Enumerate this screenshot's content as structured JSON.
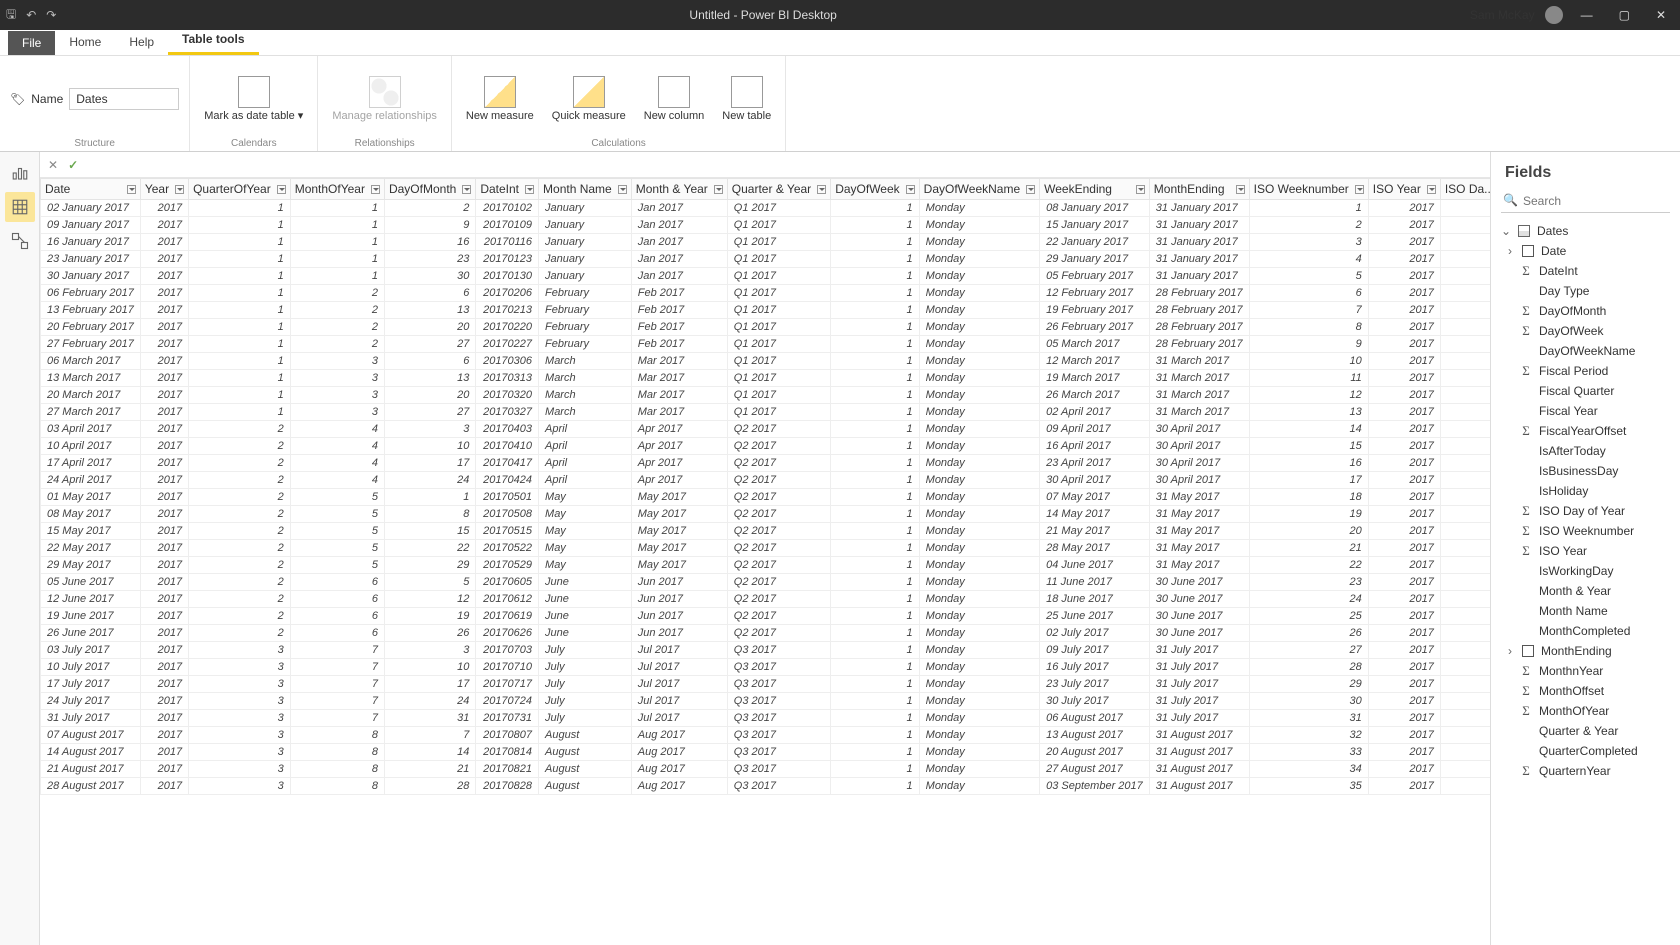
{
  "titlebar": {
    "title": "Untitled - Power BI Desktop",
    "user": "Sam McKay"
  },
  "menu": {
    "file": "File",
    "tabs": [
      "Home",
      "Help",
      "Table tools"
    ],
    "active": "Table tools"
  },
  "ribbon": {
    "name_label": "Name",
    "name_value": "Dates",
    "mark": "Mark as date\ntable ▾",
    "manage": "Manage\nrelationships",
    "new_measure": "New\nmeasure",
    "quick_measure": "Quick\nmeasure",
    "new_column": "New\ncolumn",
    "new_table": "New\ntable",
    "g1": "Structure",
    "g2": "Calendars",
    "g3": "Relationships",
    "g4": "Calculations"
  },
  "fields_panel": {
    "title": "Fields",
    "search_placeholder": "Search",
    "table": "Dates",
    "items": [
      {
        "t": "date",
        "n": "Date",
        "exp": true
      },
      {
        "t": "sigma",
        "n": "DateInt"
      },
      {
        "t": "none",
        "n": "Day Type"
      },
      {
        "t": "sigma",
        "n": "DayOfMonth"
      },
      {
        "t": "sigma",
        "n": "DayOfWeek"
      },
      {
        "t": "none",
        "n": "DayOfWeekName"
      },
      {
        "t": "sigma",
        "n": "Fiscal Period"
      },
      {
        "t": "none",
        "n": "Fiscal Quarter"
      },
      {
        "t": "none",
        "n": "Fiscal Year"
      },
      {
        "t": "sigma",
        "n": "FiscalYearOffset"
      },
      {
        "t": "none",
        "n": "IsAfterToday"
      },
      {
        "t": "none",
        "n": "IsBusinessDay"
      },
      {
        "t": "none",
        "n": "IsHoliday"
      },
      {
        "t": "sigma",
        "n": "ISO Day of Year"
      },
      {
        "t": "sigma",
        "n": "ISO Weeknumber"
      },
      {
        "t": "sigma",
        "n": "ISO Year"
      },
      {
        "t": "none",
        "n": "IsWorkingDay"
      },
      {
        "t": "none",
        "n": "Month & Year"
      },
      {
        "t": "none",
        "n": "Month Name"
      },
      {
        "t": "none",
        "n": "MonthCompleted"
      },
      {
        "t": "date",
        "n": "MonthEnding",
        "exp": true
      },
      {
        "t": "sigma",
        "n": "MonthnYear"
      },
      {
        "t": "sigma",
        "n": "MonthOffset"
      },
      {
        "t": "sigma",
        "n": "MonthOfYear"
      },
      {
        "t": "none",
        "n": "Quarter & Year"
      },
      {
        "t": "none",
        "n": "QuarterCompleted"
      },
      {
        "t": "sigma",
        "n": "QuarternYear"
      }
    ]
  },
  "columns": [
    "Date",
    "Year",
    "QuarterOfYear",
    "MonthOfYear",
    "DayOfMonth",
    "DateInt",
    "Month Name",
    "Month & Year",
    "Quarter & Year",
    "DayOfWeek",
    "DayOfWeekName",
    "WeekEnding",
    "MonthEnding",
    "ISO Weeknumber",
    "ISO Year",
    "ISO Da..."
  ],
  "rows": [
    [
      "02 January 2017",
      "2017",
      "1",
      "1",
      "2",
      "20170102",
      "January",
      "Jan 2017",
      "Q1 2017",
      "1",
      "Monday",
      "08 January 2017",
      "31 January 2017",
      "1",
      "2017",
      ""
    ],
    [
      "09 January 2017",
      "2017",
      "1",
      "1",
      "9",
      "20170109",
      "January",
      "Jan 2017",
      "Q1 2017",
      "1",
      "Monday",
      "15 January 2017",
      "31 January 2017",
      "2",
      "2017",
      ""
    ],
    [
      "16 January 2017",
      "2017",
      "1",
      "1",
      "16",
      "20170116",
      "January",
      "Jan 2017",
      "Q1 2017",
      "1",
      "Monday",
      "22 January 2017",
      "31 January 2017",
      "3",
      "2017",
      ""
    ],
    [
      "23 January 2017",
      "2017",
      "1",
      "1",
      "23",
      "20170123",
      "January",
      "Jan 2017",
      "Q1 2017",
      "1",
      "Monday",
      "29 January 2017",
      "31 January 2017",
      "4",
      "2017",
      ""
    ],
    [
      "30 January 2017",
      "2017",
      "1",
      "1",
      "30",
      "20170130",
      "January",
      "Jan 2017",
      "Q1 2017",
      "1",
      "Monday",
      "05 February 2017",
      "31 January 2017",
      "5",
      "2017",
      ""
    ],
    [
      "06 February 2017",
      "2017",
      "1",
      "2",
      "6",
      "20170206",
      "February",
      "Feb 2017",
      "Q1 2017",
      "1",
      "Monday",
      "12 February 2017",
      "28 February 2017",
      "6",
      "2017",
      ""
    ],
    [
      "13 February 2017",
      "2017",
      "1",
      "2",
      "13",
      "20170213",
      "February",
      "Feb 2017",
      "Q1 2017",
      "1",
      "Monday",
      "19 February 2017",
      "28 February 2017",
      "7",
      "2017",
      ""
    ],
    [
      "20 February 2017",
      "2017",
      "1",
      "2",
      "20",
      "20170220",
      "February",
      "Feb 2017",
      "Q1 2017",
      "1",
      "Monday",
      "26 February 2017",
      "28 February 2017",
      "8",
      "2017",
      ""
    ],
    [
      "27 February 2017",
      "2017",
      "1",
      "2",
      "27",
      "20170227",
      "February",
      "Feb 2017",
      "Q1 2017",
      "1",
      "Monday",
      "05 March 2017",
      "28 February 2017",
      "9",
      "2017",
      ""
    ],
    [
      "06 March 2017",
      "2017",
      "1",
      "3",
      "6",
      "20170306",
      "March",
      "Mar 2017",
      "Q1 2017",
      "1",
      "Monday",
      "12 March 2017",
      "31 March 2017",
      "10",
      "2017",
      ""
    ],
    [
      "13 March 2017",
      "2017",
      "1",
      "3",
      "13",
      "20170313",
      "March",
      "Mar 2017",
      "Q1 2017",
      "1",
      "Monday",
      "19 March 2017",
      "31 March 2017",
      "11",
      "2017",
      ""
    ],
    [
      "20 March 2017",
      "2017",
      "1",
      "3",
      "20",
      "20170320",
      "March",
      "Mar 2017",
      "Q1 2017",
      "1",
      "Monday",
      "26 March 2017",
      "31 March 2017",
      "12",
      "2017",
      ""
    ],
    [
      "27 March 2017",
      "2017",
      "1",
      "3",
      "27",
      "20170327",
      "March",
      "Mar 2017",
      "Q1 2017",
      "1",
      "Monday",
      "02 April 2017",
      "31 March 2017",
      "13",
      "2017",
      ""
    ],
    [
      "03 April 2017",
      "2017",
      "2",
      "4",
      "3",
      "20170403",
      "April",
      "Apr 2017",
      "Q2 2017",
      "1",
      "Monday",
      "09 April 2017",
      "30 April 2017",
      "14",
      "2017",
      ""
    ],
    [
      "10 April 2017",
      "2017",
      "2",
      "4",
      "10",
      "20170410",
      "April",
      "Apr 2017",
      "Q2 2017",
      "1",
      "Monday",
      "16 April 2017",
      "30 April 2017",
      "15",
      "2017",
      ""
    ],
    [
      "17 April 2017",
      "2017",
      "2",
      "4",
      "17",
      "20170417",
      "April",
      "Apr 2017",
      "Q2 2017",
      "1",
      "Monday",
      "23 April 2017",
      "30 April 2017",
      "16",
      "2017",
      ""
    ],
    [
      "24 April 2017",
      "2017",
      "2",
      "4",
      "24",
      "20170424",
      "April",
      "Apr 2017",
      "Q2 2017",
      "1",
      "Monday",
      "30 April 2017",
      "30 April 2017",
      "17",
      "2017",
      ""
    ],
    [
      "01 May 2017",
      "2017",
      "2",
      "5",
      "1",
      "20170501",
      "May",
      "May 2017",
      "Q2 2017",
      "1",
      "Monday",
      "07 May 2017",
      "31 May 2017",
      "18",
      "2017",
      ""
    ],
    [
      "08 May 2017",
      "2017",
      "2",
      "5",
      "8",
      "20170508",
      "May",
      "May 2017",
      "Q2 2017",
      "1",
      "Monday",
      "14 May 2017",
      "31 May 2017",
      "19",
      "2017",
      ""
    ],
    [
      "15 May 2017",
      "2017",
      "2",
      "5",
      "15",
      "20170515",
      "May",
      "May 2017",
      "Q2 2017",
      "1",
      "Monday",
      "21 May 2017",
      "31 May 2017",
      "20",
      "2017",
      ""
    ],
    [
      "22 May 2017",
      "2017",
      "2",
      "5",
      "22",
      "20170522",
      "May",
      "May 2017",
      "Q2 2017",
      "1",
      "Monday",
      "28 May 2017",
      "31 May 2017",
      "21",
      "2017",
      ""
    ],
    [
      "29 May 2017",
      "2017",
      "2",
      "5",
      "29",
      "20170529",
      "May",
      "May 2017",
      "Q2 2017",
      "1",
      "Monday",
      "04 June 2017",
      "31 May 2017",
      "22",
      "2017",
      ""
    ],
    [
      "05 June 2017",
      "2017",
      "2",
      "6",
      "5",
      "20170605",
      "June",
      "Jun 2017",
      "Q2 2017",
      "1",
      "Monday",
      "11 June 2017",
      "30 June 2017",
      "23",
      "2017",
      ""
    ],
    [
      "12 June 2017",
      "2017",
      "2",
      "6",
      "12",
      "20170612",
      "June",
      "Jun 2017",
      "Q2 2017",
      "1",
      "Monday",
      "18 June 2017",
      "30 June 2017",
      "24",
      "2017",
      ""
    ],
    [
      "19 June 2017",
      "2017",
      "2",
      "6",
      "19",
      "20170619",
      "June",
      "Jun 2017",
      "Q2 2017",
      "1",
      "Monday",
      "25 June 2017",
      "30 June 2017",
      "25",
      "2017",
      ""
    ],
    [
      "26 June 2017",
      "2017",
      "2",
      "6",
      "26",
      "20170626",
      "June",
      "Jun 2017",
      "Q2 2017",
      "1",
      "Monday",
      "02 July 2017",
      "30 June 2017",
      "26",
      "2017",
      ""
    ],
    [
      "03 July 2017",
      "2017",
      "3",
      "7",
      "3",
      "20170703",
      "July",
      "Jul 2017",
      "Q3 2017",
      "1",
      "Monday",
      "09 July 2017",
      "31 July 2017",
      "27",
      "2017",
      ""
    ],
    [
      "10 July 2017",
      "2017",
      "3",
      "7",
      "10",
      "20170710",
      "July",
      "Jul 2017",
      "Q3 2017",
      "1",
      "Monday",
      "16 July 2017",
      "31 July 2017",
      "28",
      "2017",
      ""
    ],
    [
      "17 July 2017",
      "2017",
      "3",
      "7",
      "17",
      "20170717",
      "July",
      "Jul 2017",
      "Q3 2017",
      "1",
      "Monday",
      "23 July 2017",
      "31 July 2017",
      "29",
      "2017",
      ""
    ],
    [
      "24 July 2017",
      "2017",
      "3",
      "7",
      "24",
      "20170724",
      "July",
      "Jul 2017",
      "Q3 2017",
      "1",
      "Monday",
      "30 July 2017",
      "31 July 2017",
      "30",
      "2017",
      ""
    ],
    [
      "31 July 2017",
      "2017",
      "3",
      "7",
      "31",
      "20170731",
      "July",
      "Jul 2017",
      "Q3 2017",
      "1",
      "Monday",
      "06 August 2017",
      "31 July 2017",
      "31",
      "2017",
      ""
    ],
    [
      "07 August 2017",
      "2017",
      "3",
      "8",
      "7",
      "20170807",
      "August",
      "Aug 2017",
      "Q3 2017",
      "1",
      "Monday",
      "13 August 2017",
      "31 August 2017",
      "32",
      "2017",
      ""
    ],
    [
      "14 August 2017",
      "2017",
      "3",
      "8",
      "14",
      "20170814",
      "August",
      "Aug 2017",
      "Q3 2017",
      "1",
      "Monday",
      "20 August 2017",
      "31 August 2017",
      "33",
      "2017",
      ""
    ],
    [
      "21 August 2017",
      "2017",
      "3",
      "8",
      "21",
      "20170821",
      "August",
      "Aug 2017",
      "Q3 2017",
      "1",
      "Monday",
      "27 August 2017",
      "31 August 2017",
      "34",
      "2017",
      ""
    ],
    [
      "28 August 2017",
      "2017",
      "3",
      "8",
      "28",
      "20170828",
      "August",
      "Aug 2017",
      "Q3 2017",
      "1",
      "Monday",
      "03 September 2017",
      "31 August 2017",
      "35",
      "2017",
      ""
    ]
  ],
  "numcols": [
    1,
    2,
    3,
    4,
    5,
    9,
    13,
    14
  ]
}
